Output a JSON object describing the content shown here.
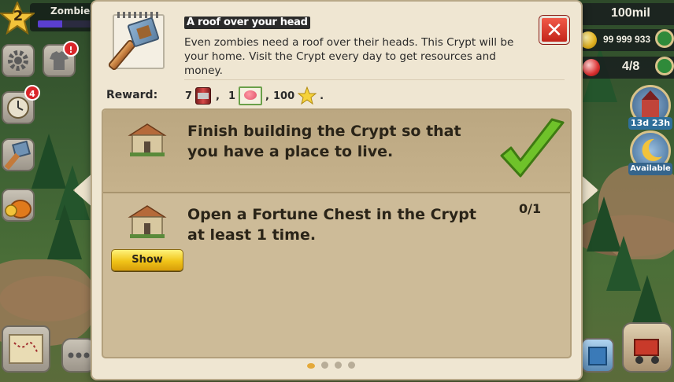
{
  "hud": {
    "level": "2",
    "player_name": "Zombie Ca",
    "xp_fraction": 0.45,
    "notifications": {
      "shop_badge": "!",
      "quests_badge": "4"
    },
    "resources": {
      "fuel": "100mil",
      "coins": "99 999 933",
      "brains": "4/8"
    },
    "timer": "13d 23h",
    "available_label": "Available"
  },
  "quest": {
    "title": "A roof over your head",
    "description": "Even zombies need a roof over their heads. This Crypt will be your home. Visit the Crypt every day to get resources and money.",
    "reward_label": "Reward:",
    "rewards": [
      {
        "amount": "7",
        "icon": "can-icon",
        "sep": ","
      },
      {
        "amount": "1",
        "icon": "brain-card-icon",
        "sep": ","
      },
      {
        "amount": "100",
        "icon": "star-icon",
        "sep": "."
      }
    ],
    "tasks": [
      {
        "text": "Finish building the Crypt so that you have a place to live.",
        "completed": true
      },
      {
        "text": "Open a Fortune Chest in the Crypt at least 1 time.",
        "progress": "0/1",
        "button": "Show"
      }
    ],
    "close_label": "✕",
    "pages": {
      "count": 4,
      "active": 1
    }
  },
  "colors": {
    "panel_bg": "#efe6d2",
    "tasks_bg": "#cdbb98",
    "check_green": "#6fc22a",
    "show_button": "#f0c419",
    "close_red": "#d9332a"
  }
}
